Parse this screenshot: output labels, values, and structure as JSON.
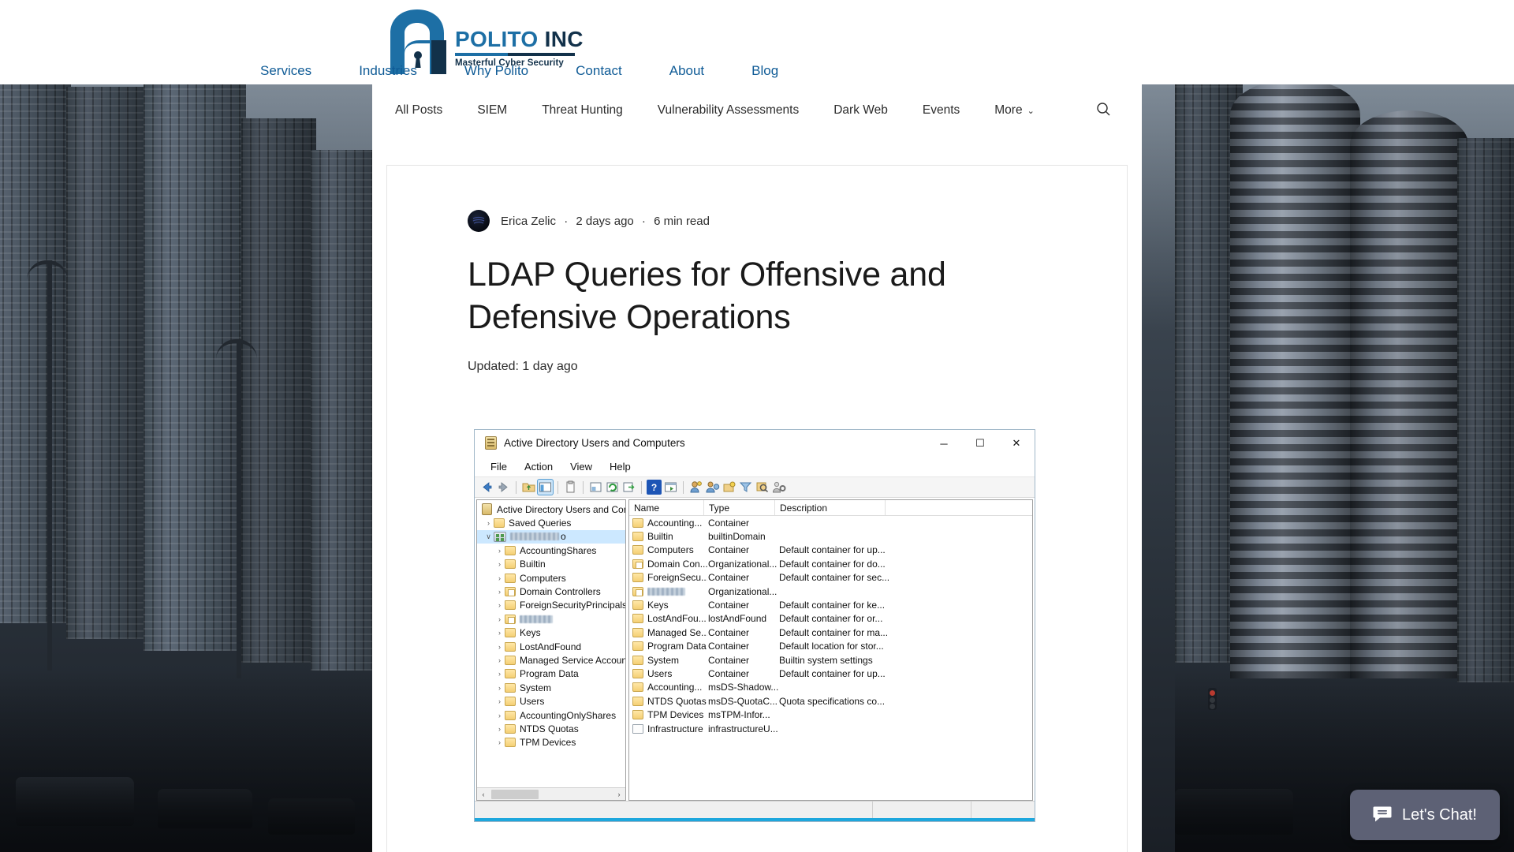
{
  "site": {
    "logo": {
      "title_part1": "POLITO",
      "title_part2": "INC",
      "tagline": "Masterful Cyber Security",
      "mark_name": "padlock-logo"
    },
    "main_nav": [
      {
        "label": "Services"
      },
      {
        "label": "Industries"
      },
      {
        "label": "Why Polito"
      },
      {
        "label": "Contact"
      },
      {
        "label": "About"
      },
      {
        "label": "Blog"
      }
    ],
    "category_bar": {
      "items": [
        {
          "label": "All Posts"
        },
        {
          "label": "SIEM"
        },
        {
          "label": "Threat Hunting"
        },
        {
          "label": "Vulnerability Assessments"
        },
        {
          "label": "Dark Web"
        },
        {
          "label": "Events"
        },
        {
          "label": "More",
          "has_chevron": true
        }
      ],
      "search_icon": "search-icon"
    }
  },
  "post": {
    "author": "Erica Zelic",
    "separator1": "·",
    "published": "2 days ago",
    "separator2": "·",
    "read_time": "6 min read",
    "title": "LDAP Queries for Offensive and Defensive Operations",
    "updated": "Updated: 1 day ago"
  },
  "screenshot": {
    "window_title": "Active Directory Users and Computers",
    "controls": {
      "minimize": "─",
      "maximize": "☐",
      "close": "✕"
    },
    "menu": [
      "File",
      "Action",
      "View",
      "Help"
    ],
    "toolbar_icons": [
      "back-arrow-icon",
      "forward-arrow-icon",
      "up-folder-icon",
      "show-hide-tree-icon",
      "properties-icon",
      "export-list-icon",
      "refresh-icon",
      "export-icon",
      "help-icon",
      "window-icon",
      "find-user-icon",
      "new-user-icon",
      "new-group-icon",
      "filter-icon",
      "search-icon",
      "settings-icon"
    ],
    "tree": [
      {
        "label": "Active Directory Users and Com",
        "indent": 0,
        "twisty": "",
        "icon": "console-root-icon"
      },
      {
        "label": "Saved Queries",
        "indent": 1,
        "twisty": "›",
        "icon": "folder-icon"
      },
      {
        "label": "",
        "redacted": true,
        "suffix": "o",
        "indent": 1,
        "twisty": "∨",
        "icon": "domain-icon",
        "selected": true
      },
      {
        "label": "AccountingShares",
        "indent": 2,
        "twisty": "›",
        "icon": "folder-icon"
      },
      {
        "label": "Builtin",
        "indent": 2,
        "twisty": "›",
        "icon": "folder-icon"
      },
      {
        "label": "Computers",
        "indent": 2,
        "twisty": "›",
        "icon": "folder-icon"
      },
      {
        "label": "Domain Controllers",
        "indent": 2,
        "twisty": "›",
        "icon": "ou-folder-icon"
      },
      {
        "label": "ForeignSecurityPrincipals",
        "indent": 2,
        "twisty": "›",
        "icon": "folder-icon"
      },
      {
        "label": "",
        "redacted": true,
        "indent": 2,
        "twisty": "›",
        "icon": "ou-folder-icon"
      },
      {
        "label": "Keys",
        "indent": 2,
        "twisty": "›",
        "icon": "folder-icon"
      },
      {
        "label": "LostAndFound",
        "indent": 2,
        "twisty": "›",
        "icon": "folder-icon"
      },
      {
        "label": "Managed Service Accounts",
        "indent": 2,
        "twisty": "›",
        "icon": "folder-icon"
      },
      {
        "label": "Program Data",
        "indent": 2,
        "twisty": "›",
        "icon": "folder-icon"
      },
      {
        "label": "System",
        "indent": 2,
        "twisty": "›",
        "icon": "folder-icon"
      },
      {
        "label": "Users",
        "indent": 2,
        "twisty": "›",
        "icon": "folder-icon"
      },
      {
        "label": "AccountingOnlyShares",
        "indent": 2,
        "twisty": "›",
        "icon": "folder-icon"
      },
      {
        "label": "NTDS Quotas",
        "indent": 2,
        "twisty": "›",
        "icon": "folder-icon"
      },
      {
        "label": "TPM Devices",
        "indent": 2,
        "twisty": "›",
        "icon": "folder-icon"
      }
    ],
    "list_columns": [
      "Name",
      "Type",
      "Description"
    ],
    "list_rows": [
      {
        "name": "Accounting...",
        "type": "Container",
        "description": "",
        "icon": "folder-icon"
      },
      {
        "name": "Builtin",
        "type": "builtinDomain",
        "description": "",
        "icon": "folder-icon"
      },
      {
        "name": "Computers",
        "type": "Container",
        "description": "Default container for up...",
        "icon": "folder-icon"
      },
      {
        "name": "Domain Con...",
        "type": "Organizational...",
        "description": "Default container for do...",
        "icon": "ou-folder-icon"
      },
      {
        "name": "ForeignSecu...",
        "type": "Container",
        "description": "Default container for sec...",
        "icon": "folder-icon"
      },
      {
        "name": "",
        "redacted": true,
        "type": "Organizational...",
        "description": "",
        "icon": "ou-folder-icon"
      },
      {
        "name": "Keys",
        "type": "Container",
        "description": "Default container for ke...",
        "icon": "folder-icon"
      },
      {
        "name": "LostAndFou...",
        "type": "lostAndFound",
        "description": "Default container for or...",
        "icon": "folder-icon"
      },
      {
        "name": "Managed Se...",
        "type": "Container",
        "description": "Default container for ma...",
        "icon": "folder-icon"
      },
      {
        "name": "Program Data",
        "type": "Container",
        "description": "Default location for stor...",
        "icon": "folder-icon"
      },
      {
        "name": "System",
        "type": "Container",
        "description": "Builtin system settings",
        "icon": "folder-icon"
      },
      {
        "name": "Users",
        "type": "Container",
        "description": "Default container for up...",
        "icon": "folder-icon"
      },
      {
        "name": "Accounting...",
        "type": "msDS-Shadow...",
        "description": "",
        "icon": "folder-icon"
      },
      {
        "name": "NTDS Quotas",
        "type": "msDS-QuotaC...",
        "description": "Quota specifications co...",
        "icon": "folder-icon"
      },
      {
        "name": "TPM Devices",
        "type": "msTPM-Infor...",
        "description": "",
        "icon": "folder-icon"
      },
      {
        "name": "Infrastructure",
        "type": "infrastructureU...",
        "description": "",
        "icon": "document-icon"
      }
    ],
    "hscroll": {
      "left_arrow": "‹",
      "right_arrow": "›"
    }
  },
  "chat": {
    "label": "Let's Chat!",
    "icon": "chat-bubble-icon"
  },
  "colors": {
    "brand_blue": "#1d6fa5",
    "brand_navy": "#12314a",
    "nav_link": "#0f5b96",
    "chat_bg": "#5d6175",
    "selection": "#cce8ff"
  }
}
